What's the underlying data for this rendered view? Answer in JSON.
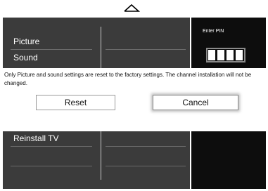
{
  "menu": {
    "items": [
      "Picture",
      "Sound",
      "Reinstall TV"
    ]
  },
  "pin": {
    "title": "Enter PIN",
    "digits": 4
  },
  "dialog": {
    "message": "Only Picture and sound settings are reset to the factory settings. The channel installation will not be changed.",
    "reset_label": "Reset",
    "cancel_label": "Cancel"
  },
  "colors": {
    "menu_bg": "#3b3b3b",
    "pin_bg": "#0d0d0d",
    "dialog_bg": "#ffffff"
  }
}
